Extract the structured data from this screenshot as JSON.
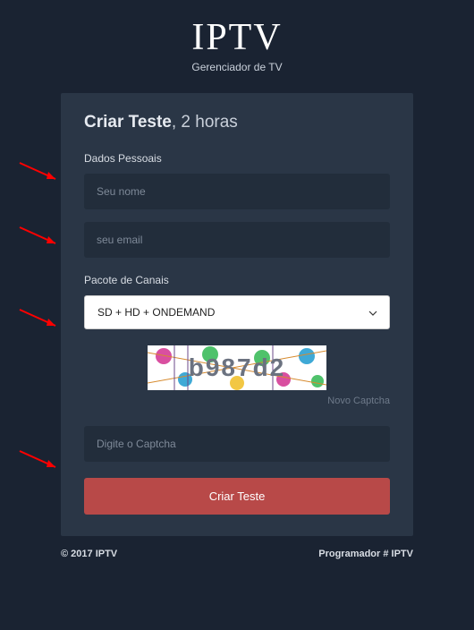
{
  "brand": {
    "title": "IPTV",
    "subtitle": "Gerenciador de TV"
  },
  "card": {
    "title_bold": "Criar Teste",
    "title_light": ", 2 horas",
    "section_personal": "Dados Pessoais",
    "name_placeholder": "Seu nome",
    "email_placeholder": "seu email",
    "section_package": "Pacote de Canais",
    "package_selected": "SD + HD + ONDEMAND",
    "captcha_value": "b987d2",
    "new_captcha": "Novo Captcha",
    "captcha_placeholder": "Digite o Captcha",
    "submit_label": "Criar Teste"
  },
  "footer": {
    "copyright": "© 2017 IPTV",
    "credit": "Programador # IPTV"
  },
  "colors": {
    "bg": "#1a2332",
    "card": "#2a3646",
    "input": "#222d3b",
    "accent": "#b84948",
    "arrow": "#ff0000"
  }
}
